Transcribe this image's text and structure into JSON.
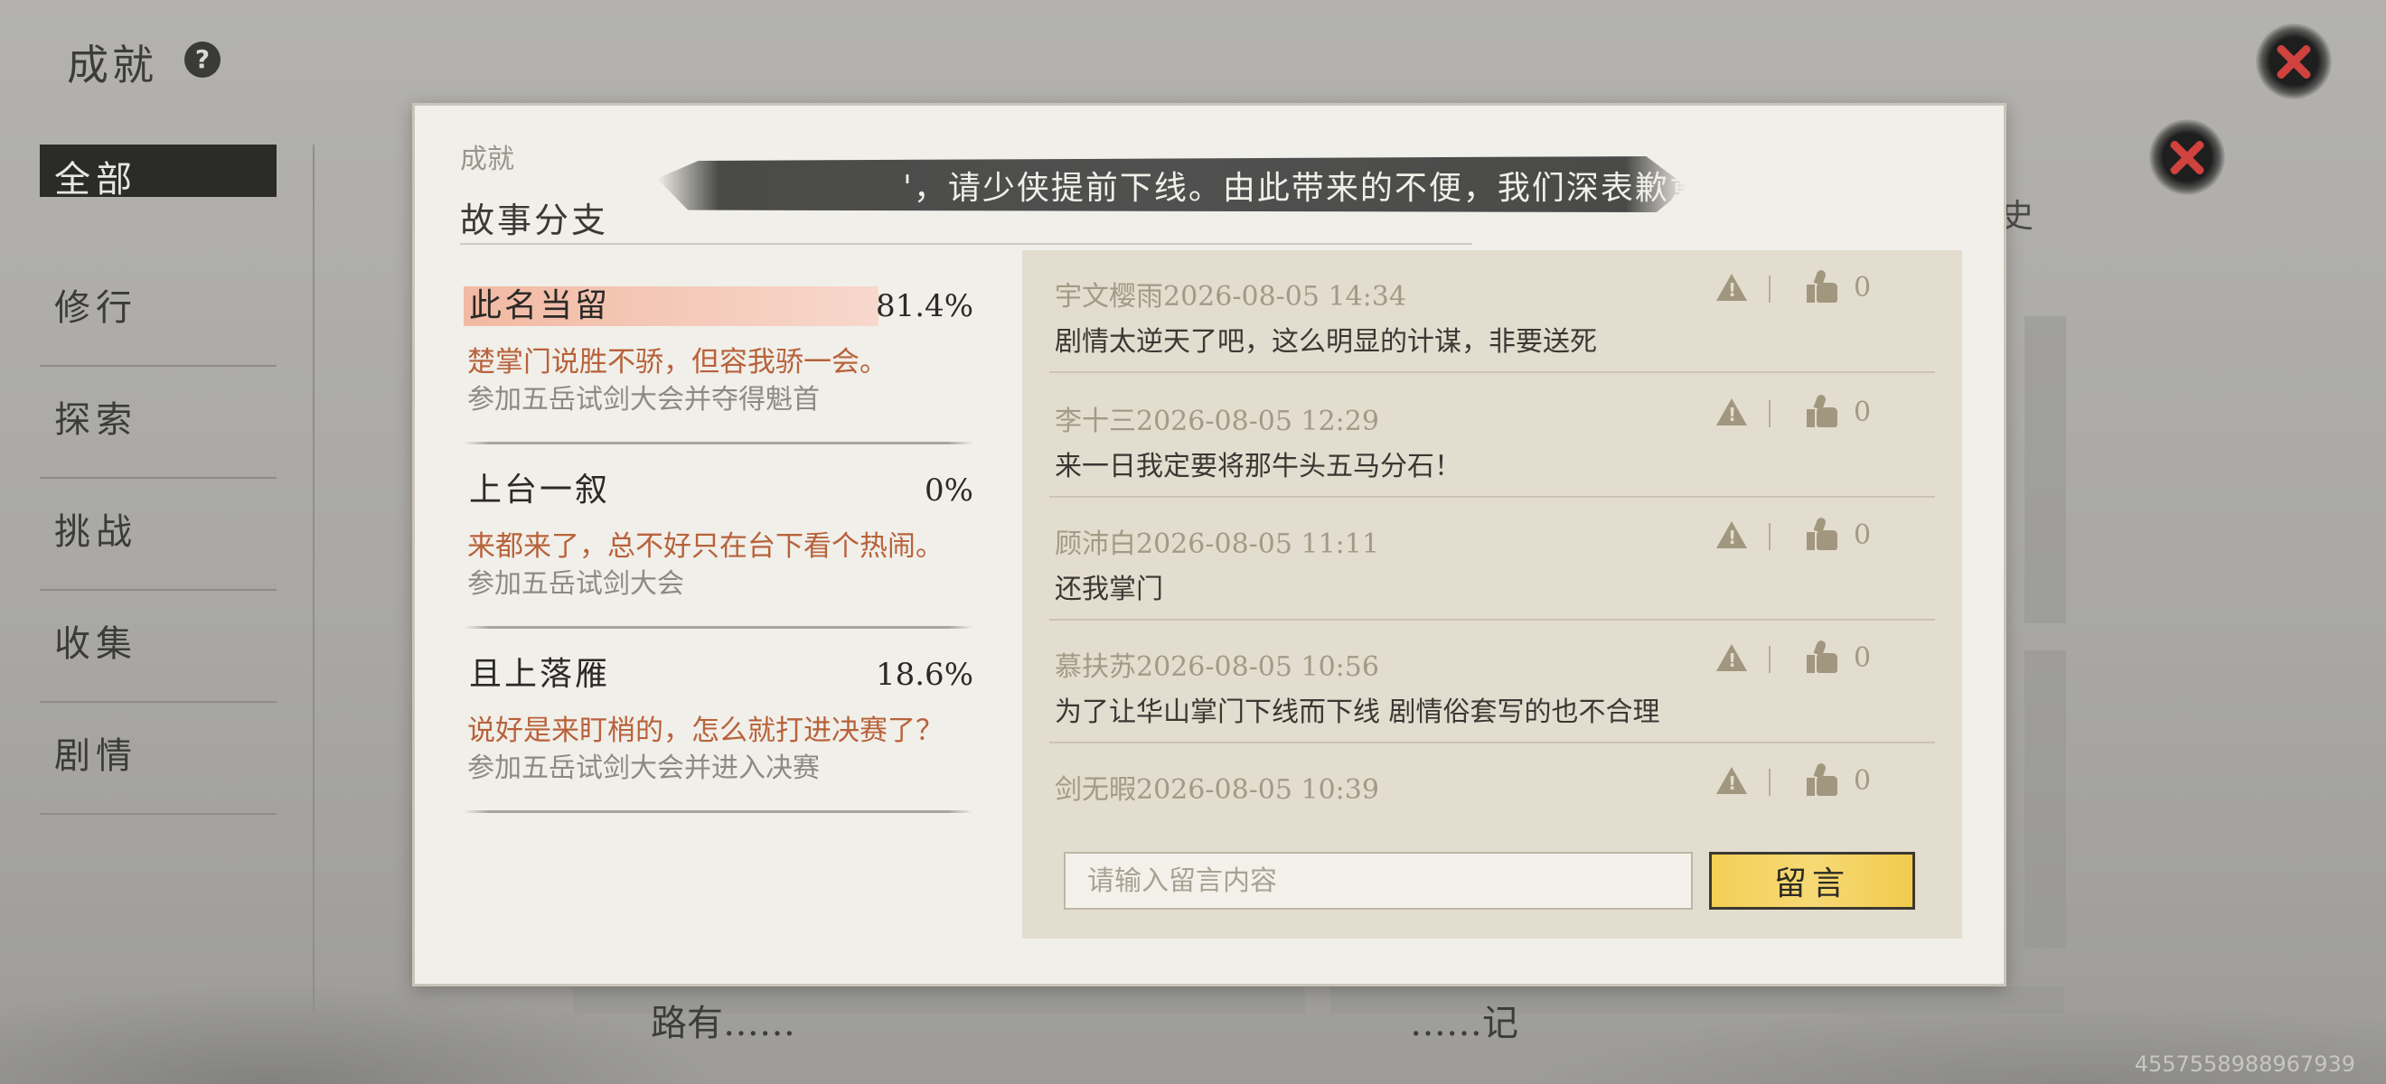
{
  "page": {
    "title": "成就",
    "help_icon": "question-icon",
    "close_icon": "close-x-icon",
    "right_edge_text": "史",
    "watermark": "4557558988967939"
  },
  "sidebar": {
    "items": [
      {
        "label": "全部",
        "active": true
      },
      {
        "label": "修行"
      },
      {
        "label": "探索"
      },
      {
        "label": "挑战"
      },
      {
        "label": "收集"
      },
      {
        "label": "剧情"
      }
    ]
  },
  "background_cards": {
    "row_left": "路有……",
    "row_right": "……记"
  },
  "modal": {
    "category": "成就",
    "title": "故事分支",
    "banner": "'，请少侠提前下线。由此带来的不便，我们深表歉意，",
    "branches": [
      {
        "name": "此名当留",
        "percent": "81.4%",
        "percent_value": 81.4,
        "quote": "楚掌门说胜不骄，但容我骄一会。",
        "condition": "参加五岳试剑大会并夺得魁首"
      },
      {
        "name": "上台一叙",
        "percent": "0%",
        "percent_value": 0,
        "quote": "来都来了，总不好只在台下看个热闹。",
        "condition": "参加五岳试剑大会"
      },
      {
        "name": "且上落雁",
        "percent": "18.6%",
        "percent_value": 18.6,
        "quote": "说好是来盯梢的，怎么就打进决赛了？",
        "condition": "参加五岳试剑大会并进入决赛"
      }
    ],
    "comments": [
      {
        "author_time": "宇文樱雨2026-08-05 14:34",
        "text": "剧情太逆天了吧，这么明显的计谋，非要送死",
        "likes": "0"
      },
      {
        "author_time": "李十三2026-08-05 12:29",
        "text": "来一日我定要将那牛头五马分石！",
        "likes": "0"
      },
      {
        "author_time": "顾沛白2026-08-05 11:11",
        "text": "还我掌门",
        "likes": "0"
      },
      {
        "author_time": "慕扶苏2026-08-05 10:56",
        "text": "为了让华山掌门下线而下线 剧情俗套写的也不合理",
        "likes": "0"
      },
      {
        "author_time": "剑无暇2026-08-05 10:39",
        "text": "",
        "likes": "0"
      }
    ],
    "input": {
      "placeholder": "请输入留言内容",
      "value": ""
    },
    "submit_label": "留言",
    "colors": {
      "highlight_bar": "#f2b9a3",
      "quote_text": "#b8623b",
      "button": "#f3cf55"
    }
  }
}
